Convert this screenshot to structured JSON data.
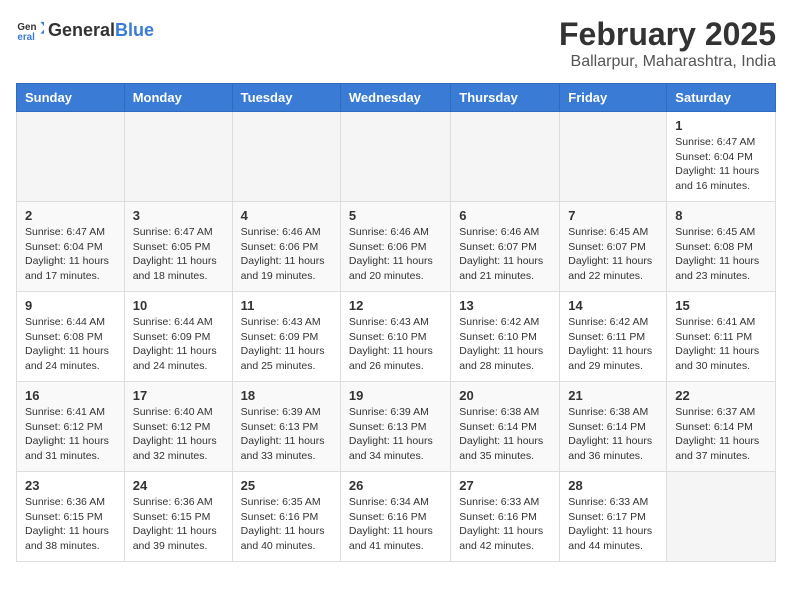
{
  "logo": {
    "general": "General",
    "blue": "Blue"
  },
  "title": {
    "month": "February 2025",
    "location": "Ballarpur, Maharashtra, India"
  },
  "headers": [
    "Sunday",
    "Monday",
    "Tuesday",
    "Wednesday",
    "Thursday",
    "Friday",
    "Saturday"
  ],
  "weeks": [
    [
      {
        "day": "",
        "info": ""
      },
      {
        "day": "",
        "info": ""
      },
      {
        "day": "",
        "info": ""
      },
      {
        "day": "",
        "info": ""
      },
      {
        "day": "",
        "info": ""
      },
      {
        "day": "",
        "info": ""
      },
      {
        "day": "1",
        "info": "Sunrise: 6:47 AM\nSunset: 6:04 PM\nDaylight: 11 hours\nand 16 minutes."
      }
    ],
    [
      {
        "day": "2",
        "info": "Sunrise: 6:47 AM\nSunset: 6:04 PM\nDaylight: 11 hours\nand 17 minutes."
      },
      {
        "day": "3",
        "info": "Sunrise: 6:47 AM\nSunset: 6:05 PM\nDaylight: 11 hours\nand 18 minutes."
      },
      {
        "day": "4",
        "info": "Sunrise: 6:46 AM\nSunset: 6:06 PM\nDaylight: 11 hours\nand 19 minutes."
      },
      {
        "day": "5",
        "info": "Sunrise: 6:46 AM\nSunset: 6:06 PM\nDaylight: 11 hours\nand 20 minutes."
      },
      {
        "day": "6",
        "info": "Sunrise: 6:46 AM\nSunset: 6:07 PM\nDaylight: 11 hours\nand 21 minutes."
      },
      {
        "day": "7",
        "info": "Sunrise: 6:45 AM\nSunset: 6:07 PM\nDaylight: 11 hours\nand 22 minutes."
      },
      {
        "day": "8",
        "info": "Sunrise: 6:45 AM\nSunset: 6:08 PM\nDaylight: 11 hours\nand 23 minutes."
      }
    ],
    [
      {
        "day": "9",
        "info": "Sunrise: 6:44 AM\nSunset: 6:08 PM\nDaylight: 11 hours\nand 24 minutes."
      },
      {
        "day": "10",
        "info": "Sunrise: 6:44 AM\nSunset: 6:09 PM\nDaylight: 11 hours\nand 24 minutes."
      },
      {
        "day": "11",
        "info": "Sunrise: 6:43 AM\nSunset: 6:09 PM\nDaylight: 11 hours\nand 25 minutes."
      },
      {
        "day": "12",
        "info": "Sunrise: 6:43 AM\nSunset: 6:10 PM\nDaylight: 11 hours\nand 26 minutes."
      },
      {
        "day": "13",
        "info": "Sunrise: 6:42 AM\nSunset: 6:10 PM\nDaylight: 11 hours\nand 28 minutes."
      },
      {
        "day": "14",
        "info": "Sunrise: 6:42 AM\nSunset: 6:11 PM\nDaylight: 11 hours\nand 29 minutes."
      },
      {
        "day": "15",
        "info": "Sunrise: 6:41 AM\nSunset: 6:11 PM\nDaylight: 11 hours\nand 30 minutes."
      }
    ],
    [
      {
        "day": "16",
        "info": "Sunrise: 6:41 AM\nSunset: 6:12 PM\nDaylight: 11 hours\nand 31 minutes."
      },
      {
        "day": "17",
        "info": "Sunrise: 6:40 AM\nSunset: 6:12 PM\nDaylight: 11 hours\nand 32 minutes."
      },
      {
        "day": "18",
        "info": "Sunrise: 6:39 AM\nSunset: 6:13 PM\nDaylight: 11 hours\nand 33 minutes."
      },
      {
        "day": "19",
        "info": "Sunrise: 6:39 AM\nSunset: 6:13 PM\nDaylight: 11 hours\nand 34 minutes."
      },
      {
        "day": "20",
        "info": "Sunrise: 6:38 AM\nSunset: 6:14 PM\nDaylight: 11 hours\nand 35 minutes."
      },
      {
        "day": "21",
        "info": "Sunrise: 6:38 AM\nSunset: 6:14 PM\nDaylight: 11 hours\nand 36 minutes."
      },
      {
        "day": "22",
        "info": "Sunrise: 6:37 AM\nSunset: 6:14 PM\nDaylight: 11 hours\nand 37 minutes."
      }
    ],
    [
      {
        "day": "23",
        "info": "Sunrise: 6:36 AM\nSunset: 6:15 PM\nDaylight: 11 hours\nand 38 minutes."
      },
      {
        "day": "24",
        "info": "Sunrise: 6:36 AM\nSunset: 6:15 PM\nDaylight: 11 hours\nand 39 minutes."
      },
      {
        "day": "25",
        "info": "Sunrise: 6:35 AM\nSunset: 6:16 PM\nDaylight: 11 hours\nand 40 minutes."
      },
      {
        "day": "26",
        "info": "Sunrise: 6:34 AM\nSunset: 6:16 PM\nDaylight: 11 hours\nand 41 minutes."
      },
      {
        "day": "27",
        "info": "Sunrise: 6:33 AM\nSunset: 6:16 PM\nDaylight: 11 hours\nand 42 minutes."
      },
      {
        "day": "28",
        "info": "Sunrise: 6:33 AM\nSunset: 6:17 PM\nDaylight: 11 hours\nand 44 minutes."
      },
      {
        "day": "",
        "info": ""
      }
    ]
  ]
}
